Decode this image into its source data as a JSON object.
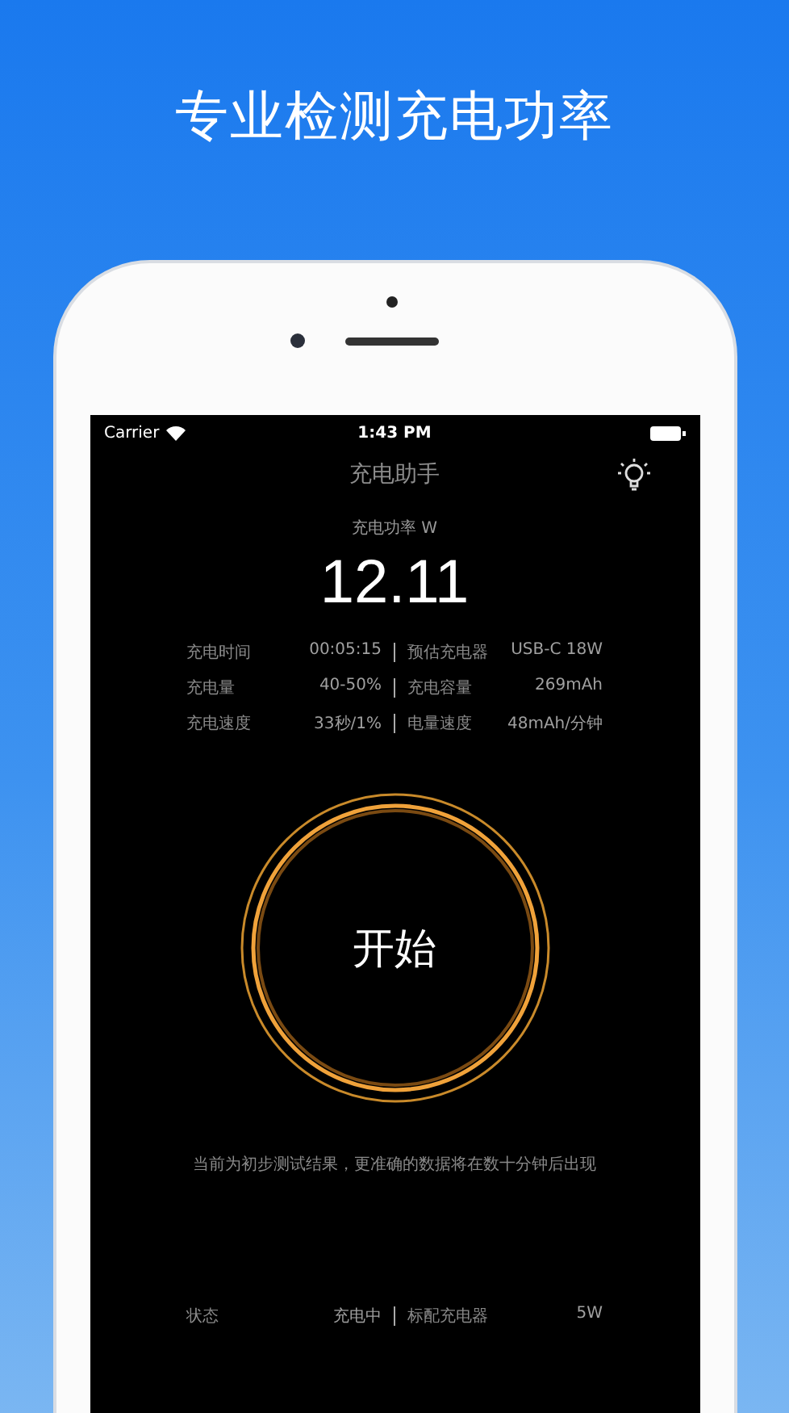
{
  "headline": "专业检测充电功率",
  "status_bar": {
    "carrier": "Carrier",
    "time": "1:43 PM"
  },
  "nav": {
    "title": "充电助手"
  },
  "power": {
    "label": "充电功率 W",
    "value": "12.11"
  },
  "stats": [
    {
      "label": "充电时间",
      "value": "00:05:15",
      "label_2": "预估充电器",
      "value_2": "USB-C 18W"
    },
    {
      "label": "充电量",
      "value": "40-50%",
      "label_2": "充电容量",
      "value_2": "269mAh"
    },
    {
      "label": "充电速度",
      "value": "33秒/1%",
      "label_2": "电量速度",
      "value_2": "48mAh/分钟"
    }
  ],
  "start_button": "开始",
  "note": "当前为初步测试结果，更准确的数据将在数十分钟后出现",
  "details": [
    {
      "label": "状态",
      "value": "充电中",
      "label_2": "标配充电器",
      "value_2": "5W"
    }
  ]
}
